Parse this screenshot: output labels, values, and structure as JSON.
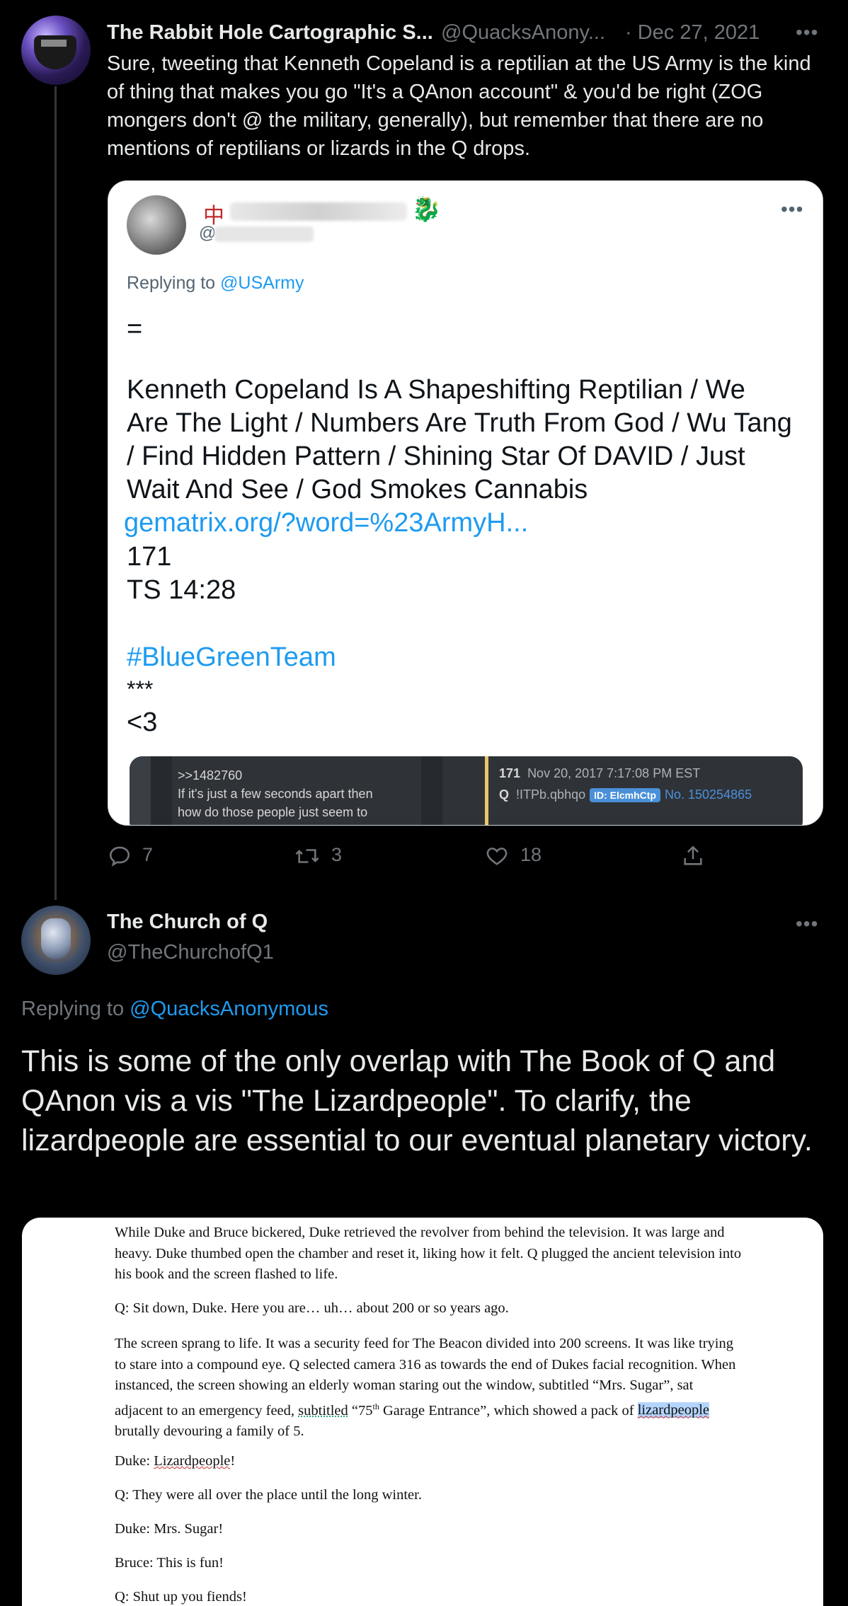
{
  "tweet1": {
    "name": "The Rabbit Hole Cartographic S...",
    "handle": "@QuacksAnony...",
    "date": "· Dec 27, 2021",
    "more": "•••",
    "text": "Sure, tweeting that Kenneth Copeland is a reptilian at the US Army is the kind of thing that makes you go \"It's a QAnon account\" & you'd be right (ZOG mongers don't @ the military, generally), but remember that there are no mentions of reptilians or lizards in the Q drops.",
    "quote": {
      "name_glyph": "中",
      "handle_at": "@",
      "emoji": "🐉",
      "more": "•••",
      "replying_prefix": "Replying to",
      "replying_to": "@USArmy",
      "equals": "=",
      "body": "Kenneth Copeland Is A Shapeshifting Reptilian / We Are The Light / Numbers Are Truth From God / Wu Tang / Find Hidden Pattern / Shining Star Of DAVID / Just Wait And See / God Smokes Cannabis",
      "link": "gematrix.org/?word=%23ArmyH...",
      "line_171": "171",
      "line_ts": "TS 14:28",
      "hashtag": "#BlueGreenTeam",
      "stars": "***",
      "heart": "<3",
      "embed": {
        "post_ref": ">>1482760",
        "post_text": "If it's just a few seconds apart then how do those people just seem to",
        "num": "171",
        "timestamp": "Nov 20, 2017 7:17:08 PM EST",
        "author": "Q",
        "trip": "!ITPb.qbhqo",
        "id_badge": "ID: ElcmhCtp",
        "post_no": "No. 150254865"
      }
    },
    "actions": {
      "replies": "7",
      "retweets": "3",
      "likes": "18"
    }
  },
  "tweet2": {
    "name": "The Church of Q",
    "handle": "@TheChurchofQ1",
    "more": "•••",
    "replying_prefix": "Replying to",
    "replying_to": "@QuacksAnonymous",
    "text": "This is some of the only overlap with The Book of Q and QAnon vis a vis \"The Lizardpeople\". To clarify, the lizardpeople are essential to our eventual planetary victory.",
    "document": {
      "p1": "While Duke and Bruce bickered, Duke retrieved the revolver from behind the television. It was large and heavy. Duke thumbed open the chamber and reset it, liking how it felt. Q plugged the ancient television into his book and the screen flashed to life.",
      "p2": "Q: Sit down, Duke. Here you are… uh… about 200 or so years ago.",
      "p3a": "The screen sprang to life. It was a security feed for The Beacon divided into 200 screens. It was like trying to stare into a compound eye. Q selected camera 316 as towards the end of Dukes facial recognition. When instanced, the screen showing an elderly woman staring out the window, subtitled “Mrs. Sugar”, sat adjacent to an emergency feed,",
      "p3_subtitled": "subtitled",
      "p3_75": "“75",
      "p3_th": "th",
      "p3_garage": "Garage Entrance”, which showed a pack of",
      "p3_lizard": "lizardpeople",
      "p3_end": "brutally devouring a family of 5.",
      "p4_speaker": "Duke:",
      "p4_word": "Lizardpeople",
      "p4_bang": "!",
      "p5": "Q: They were all over the place until the long winter.",
      "p6": "Duke: Mrs. Sugar!",
      "p7": "Bruce: This is fun!",
      "p8": "Q: Shut up you fiends!"
    }
  }
}
